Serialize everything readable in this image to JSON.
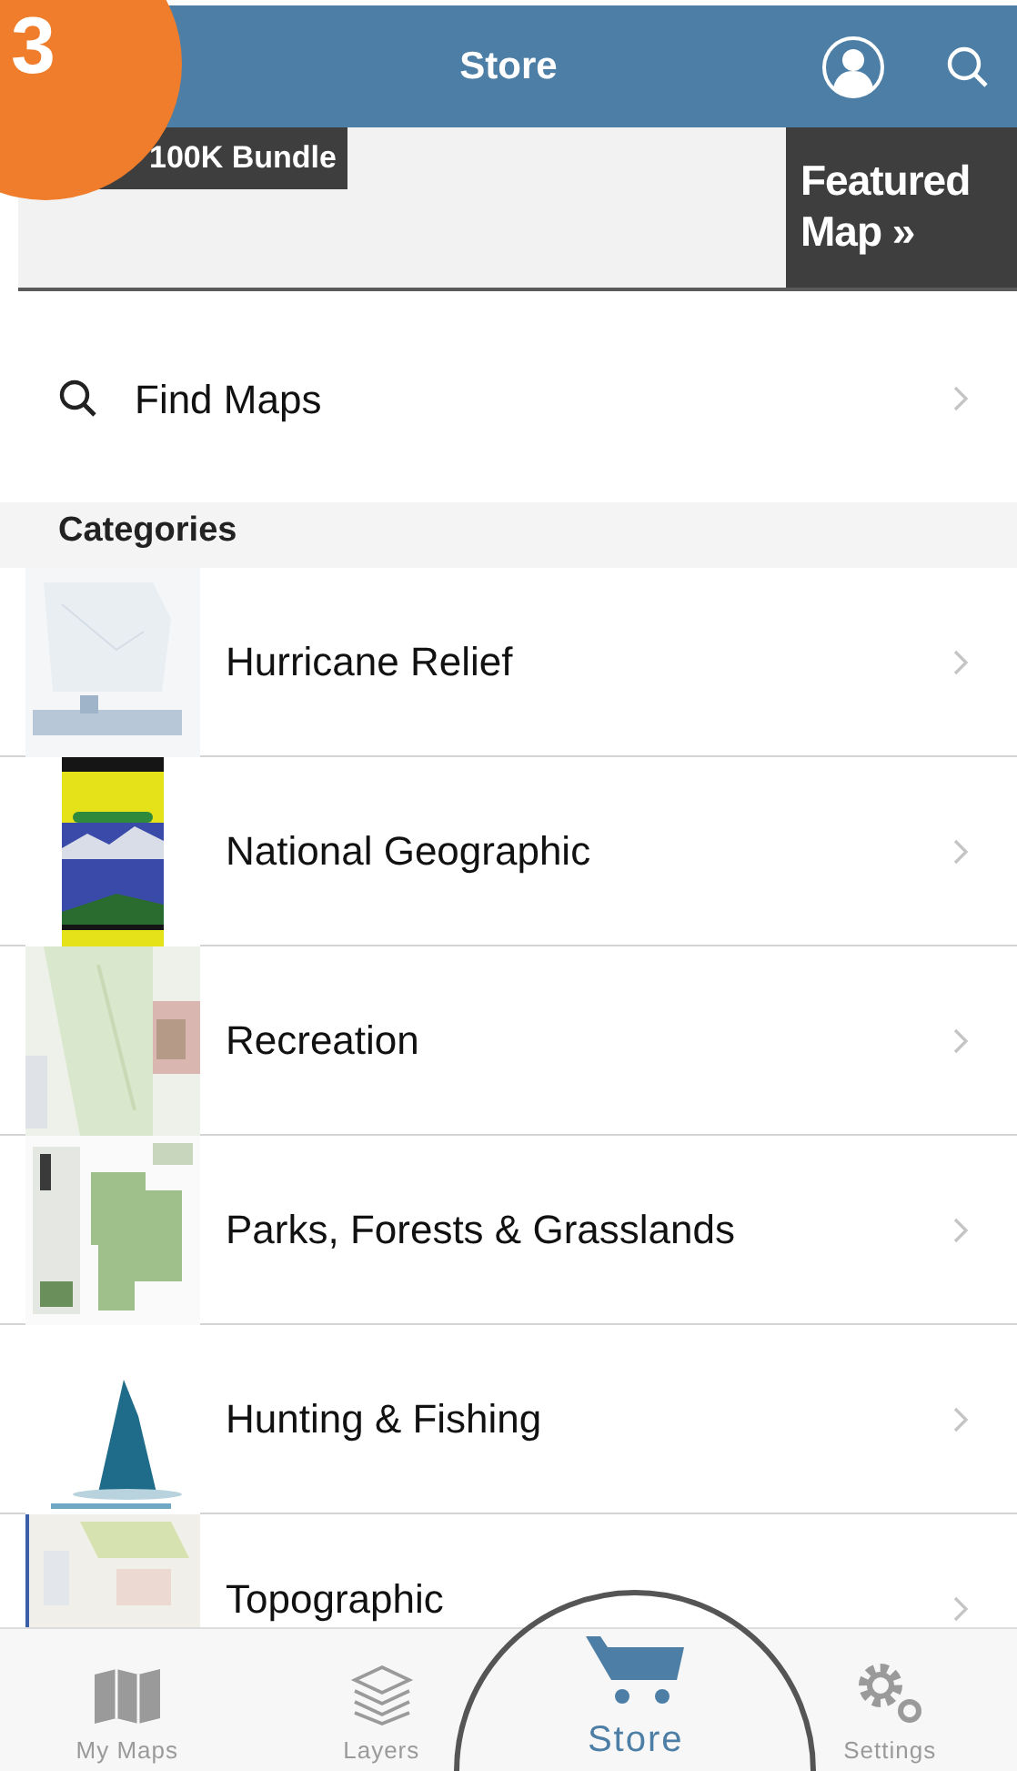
{
  "step_badge": "3",
  "header": {
    "title": "Store"
  },
  "banner": {
    "label": "100K Bundle",
    "featured": "Featured",
    "featured_link": "Map »"
  },
  "find_maps": {
    "label": "Find Maps"
  },
  "categories": {
    "heading": "Categories",
    "items": [
      {
        "label": "Hurricane Relief"
      },
      {
        "label": "National Geographic"
      },
      {
        "label": "Recreation"
      },
      {
        "label": "Parks, Forests & Grasslands"
      },
      {
        "label": "Hunting & Fishing"
      },
      {
        "label": "Topographic"
      }
    ]
  },
  "tab_bar": [
    {
      "label": "My Maps",
      "selected": false
    },
    {
      "label": "Layers",
      "selected": false
    },
    {
      "label": "Store",
      "selected": true
    },
    {
      "label": "Settings",
      "selected": false
    }
  ]
}
